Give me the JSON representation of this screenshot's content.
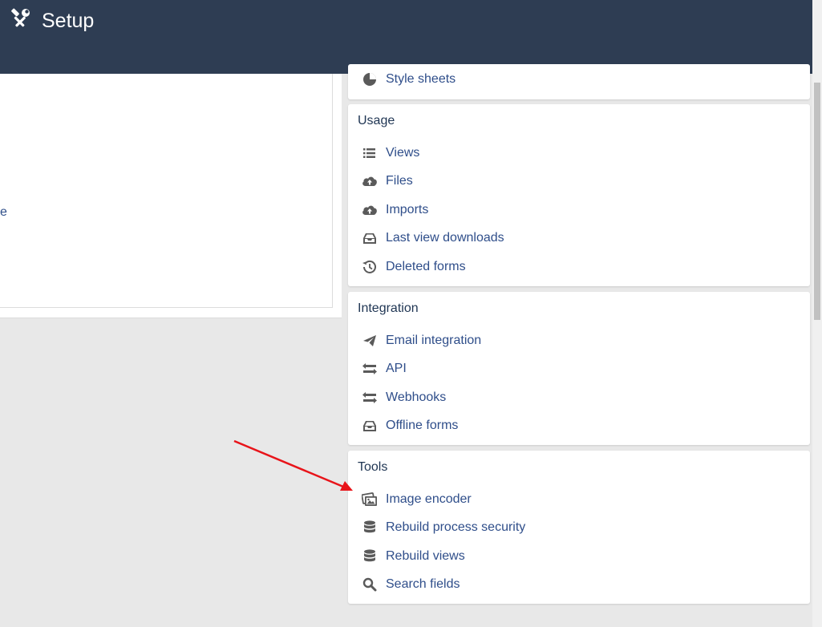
{
  "header": {
    "title": "Setup",
    "icon": "tools-icon",
    "bg_color": "#2e3d53"
  },
  "left_panel": {
    "truncated_text": "e"
  },
  "sections": {
    "top_partial": {
      "items": [
        {
          "label": "Style sheets",
          "icon": "palette-icon"
        }
      ]
    },
    "usage": {
      "title": "Usage",
      "items": [
        {
          "label": "Views",
          "icon": "list-icon"
        },
        {
          "label": "Files",
          "icon": "cloud-upload-icon"
        },
        {
          "label": "Imports",
          "icon": "cloud-upload-icon"
        },
        {
          "label": "Last view downloads",
          "icon": "inbox-download-icon"
        },
        {
          "label": "Deleted forms",
          "icon": "history-icon"
        }
      ]
    },
    "integration": {
      "title": "Integration",
      "items": [
        {
          "label": "Email integration",
          "icon": "paper-plane-icon"
        },
        {
          "label": "API",
          "icon": "exchange-icon"
        },
        {
          "label": "Webhooks",
          "icon": "exchange-icon"
        },
        {
          "label": "Offline forms",
          "icon": "inbox-download-icon"
        }
      ]
    },
    "tools": {
      "title": "Tools",
      "items": [
        {
          "label": "Image encoder",
          "icon": "images-icon"
        },
        {
          "label": "Rebuild process security",
          "icon": "database-icon"
        },
        {
          "label": "Rebuild views",
          "icon": "database-icon"
        },
        {
          "label": "Search fields",
          "icon": "search-icon"
        }
      ]
    }
  },
  "annotation": {
    "arrow_color": "#e8141a",
    "points_to": "Image encoder"
  },
  "colors": {
    "link": "#2f4e8a",
    "icon": "#5a5a5a",
    "page_bg": "#e8e8e8"
  }
}
